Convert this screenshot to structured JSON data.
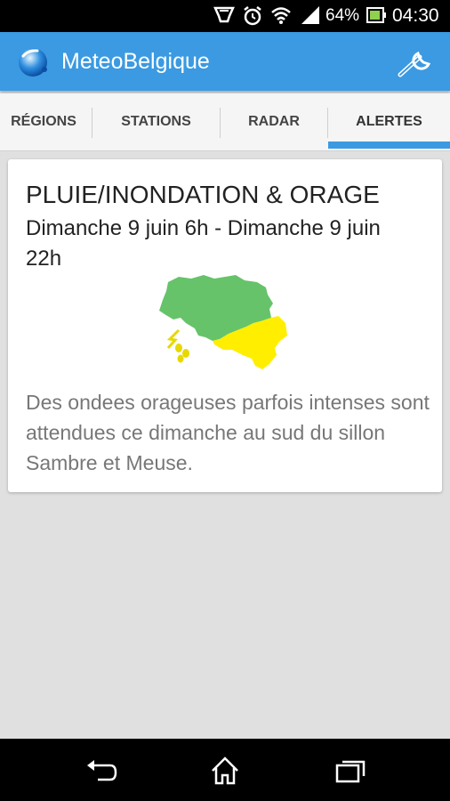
{
  "status_bar": {
    "battery": "64%",
    "time": "04:30"
  },
  "app": {
    "title": "MeteoBelgique"
  },
  "tabs": [
    {
      "label": "RÉGIONS",
      "active": false
    },
    {
      "label": "STATIONS",
      "active": false
    },
    {
      "label": "RADAR",
      "active": false
    },
    {
      "label": "ALERTES",
      "active": true
    }
  ],
  "alert": {
    "title": "PLUIE/INONDATION & ORAGE",
    "period": "Dimanche 9 juin 6h - Dimanche 9 juin 22h",
    "description": "Des ondees orageuses parfois intenses sont attendues ce dimanche au sud du sillon Sambre et Meuse.",
    "map": {
      "north_level_color": "#66c36a",
      "south_level_color": "#ffee00",
      "icon": "thunderstorm-rain-icon"
    }
  },
  "colors": {
    "accent": "#3b9ae1",
    "status_bar": "#000000",
    "background": "#e0e0e0"
  }
}
